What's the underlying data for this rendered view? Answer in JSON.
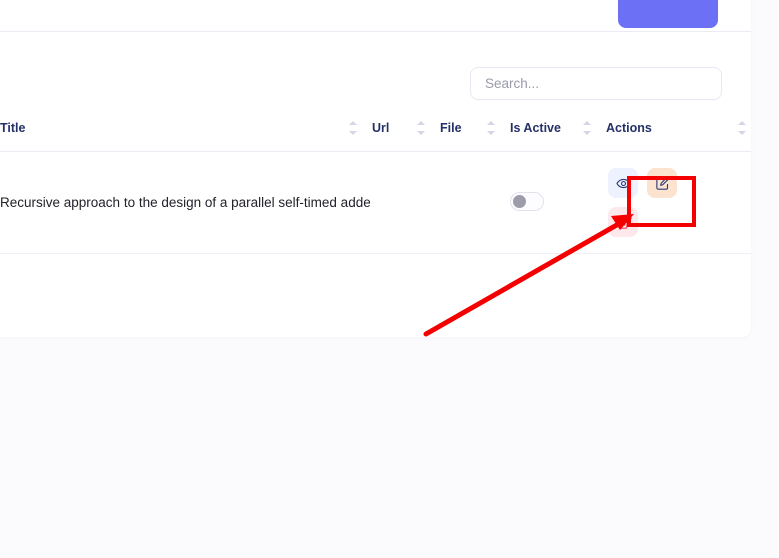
{
  "page": {
    "background_color": "#fbfbfe",
    "card_background": "#ffffff"
  },
  "header": {
    "primary_button_label": "",
    "primary_button_color": "#6b70f5",
    "primary_button_name": "add-new-button"
  },
  "search": {
    "value": "",
    "placeholder": "Search..."
  },
  "table": {
    "columns": [
      {
        "label": "Title",
        "sortable": true
      },
      {
        "label": "Url",
        "sortable": true
      },
      {
        "label": "File",
        "sortable": true
      },
      {
        "label": "Is Active",
        "sortable": true
      },
      {
        "label": "Actions",
        "sortable": true
      }
    ],
    "rows": [
      {
        "title": "Recursive approach to the design of a parallel self-timed adde",
        "url": "",
        "file": "",
        "is_active": false,
        "actions": [
          {
            "name": "view-button",
            "icon": "eye-icon",
            "bg": "#eef1fe",
            "fg": "#2c3a7a"
          },
          {
            "name": "edit-button",
            "icon": "edit-square-pencil-icon",
            "bg": "#fbe3cf",
            "fg": "#2c3a7a"
          },
          {
            "name": "delete-button",
            "icon": "trash-icon",
            "bg": "#fde9ec",
            "fg": "#ef4056"
          }
        ]
      }
    ]
  },
  "annotations": {
    "highlight_color": "#f40000",
    "highlight_target": "edit-button",
    "arrow_color": "#f40000"
  }
}
